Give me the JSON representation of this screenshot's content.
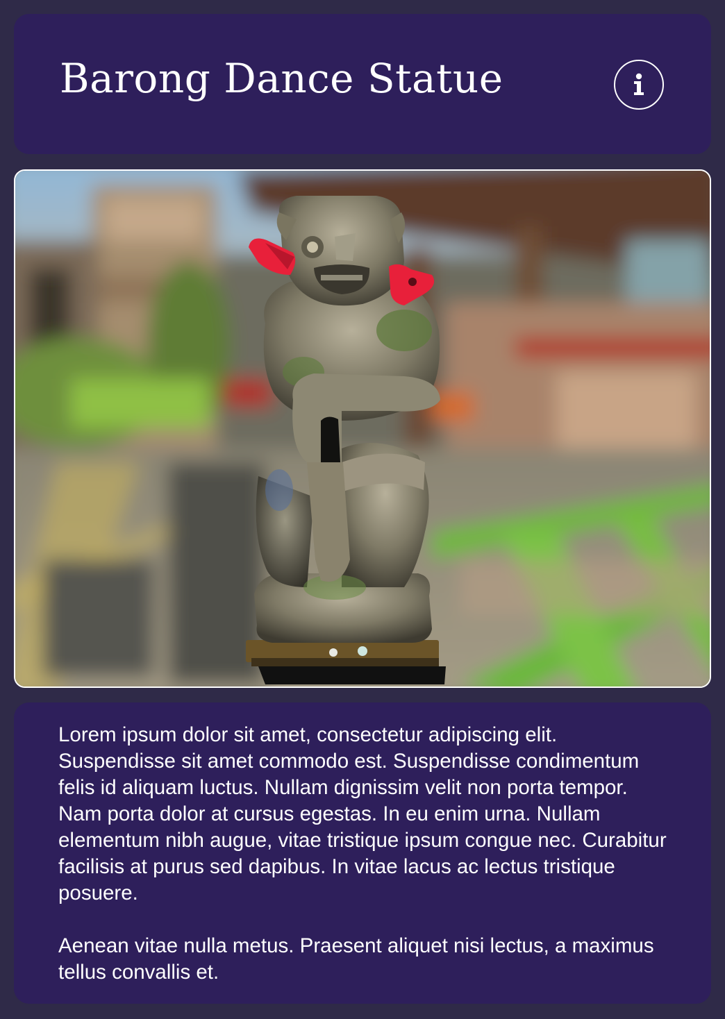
{
  "header": {
    "title": "Barong Dance Statue",
    "info_icon": "info-icon"
  },
  "viewer": {
    "subject": "statue-model",
    "accent_red": "#e8203a"
  },
  "description": {
    "paragraphs": [
      "Lorem ipsum dolor sit amet, consectetur adipiscing elit. Suspendisse sit amet commodo est. Suspendisse condimentum felis id aliquam luctus. Nullam dignissim velit non porta tempor. Nam porta dolor at cursus egestas. In eu enim urna. Nullam elementum nibh augue, vitae tristique ipsum congue nec. Curabitur facilisis at purus sed dapibus. In vitae lacus ac lectus tristique posuere.",
      "Aenean vitae nulla metus. Praesent aliquet nisi lectus, a maximus tellus convallis et."
    ]
  },
  "colors": {
    "page_background": "#2f2a48",
    "card_background": "#2e1f5b",
    "text": "#ffffff"
  }
}
